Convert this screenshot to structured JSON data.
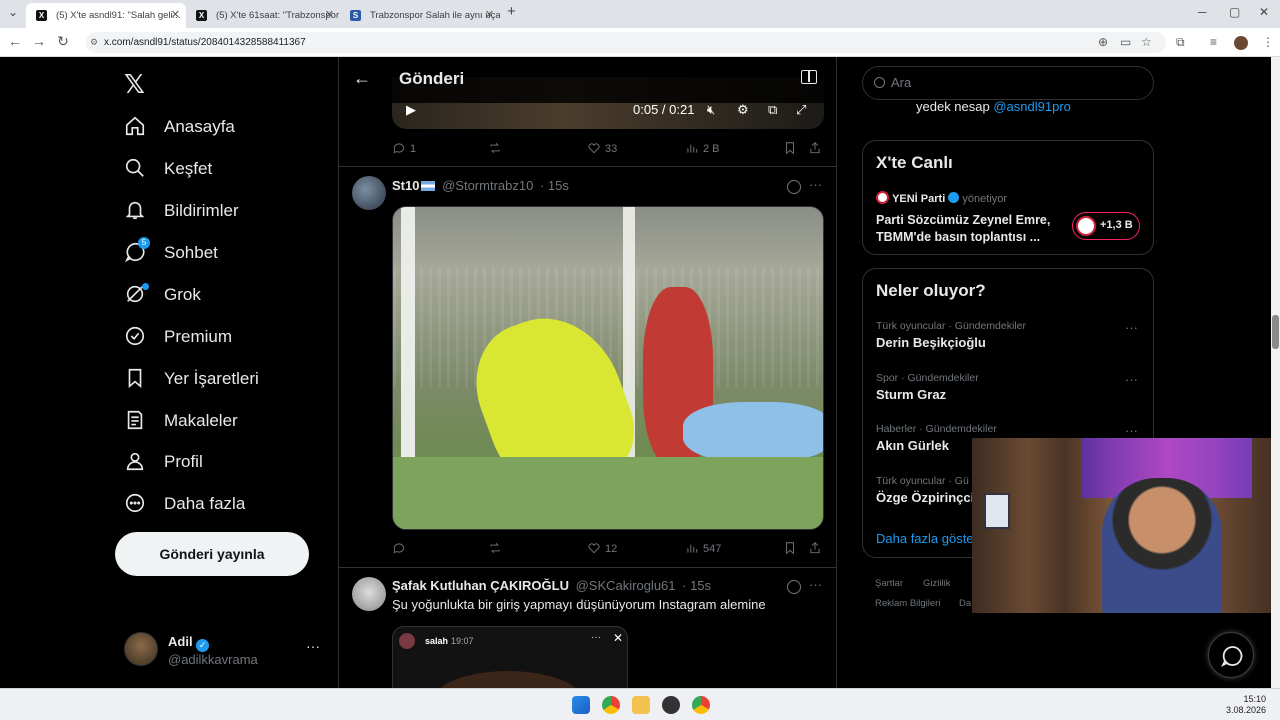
{
  "browser": {
    "tabs": [
      {
        "label": "(5) X'te asndl91: \"Salah geli...",
        "active": true
      },
      {
        "label": "(5) X'te 61saat: \"Trabzonspor Sa...",
        "active": false
      },
      {
        "label": "Trabzonspor Salah ile aynı uçak...",
        "active": false
      }
    ],
    "new_tab": "+",
    "url": "x.com/asndl91/status/2084014328588411367"
  },
  "nav": {
    "items": [
      {
        "label": "Anasayfa",
        "icon": "home-icon"
      },
      {
        "label": "Keşfet",
        "icon": "search-icon"
      },
      {
        "label": "Bildirimler",
        "icon": "bell-icon"
      },
      {
        "label": "Sohbet",
        "icon": "chat-icon",
        "badge": "5"
      },
      {
        "label": "Grok",
        "icon": "grok-icon"
      },
      {
        "label": "Premium",
        "icon": "premium-icon"
      },
      {
        "label": "Yer İşaretleri",
        "icon": "bookmark-icon"
      },
      {
        "label": "Makaleler",
        "icon": "article-icon"
      },
      {
        "label": "Profil",
        "icon": "person-icon"
      },
      {
        "label": "Daha fazla",
        "icon": "more-circle-icon"
      }
    ],
    "post_button": "Gönderi yayınla",
    "account": {
      "name": "Adil",
      "handle": "@adilkkavrama",
      "more": "···"
    }
  },
  "main": {
    "title": "Gönderi",
    "video1": {
      "time": "0:05 / 0:21"
    },
    "post1_actions": {
      "replies": "1",
      "reposts": "",
      "likes": "33",
      "views": "2 B"
    },
    "post2": {
      "name": "St10",
      "handle": "@Stormtrabz10",
      "time": "· 15s",
      "actions": {
        "replies": "",
        "reposts": "",
        "likes": "12",
        "views": "547"
      }
    },
    "post3": {
      "name": "Şafak Kutluhan ÇAKIROĞLU",
      "handle": "@SKCakiroglu61",
      "time": "· 15s",
      "text": "Şu yoğunlukta bir giriş yapmayı düşünüyorum Instagram alemine",
      "embed_user": "salah",
      "embed_time": "19:07"
    }
  },
  "right": {
    "search_placeholder": "Ara",
    "partial_text": "yedek nesap",
    "partial_link": "@asndl91pro",
    "live": {
      "title": "X'te Canlı",
      "host": "YENİ Parti",
      "host_role": "yönetiyor",
      "headline": "Parti Sözcümüz Zeynel Emre, TBMM'de basın toplantısı ...",
      "listeners": "+1,3 B"
    },
    "trends": {
      "title": "Neler oluyor?",
      "items": [
        {
          "meta": "Türk oyuncular · Gündemdekiler",
          "name": "Derin Beşikçioğlu"
        },
        {
          "meta": "Spor · Gündemdekiler",
          "name": "Sturm Graz"
        },
        {
          "meta": "Haberler · Gündemdekiler",
          "name": "Akın Gürlek"
        },
        {
          "meta": "Türk oyuncular · Gü",
          "name": "Özge Özpirinçci"
        }
      ],
      "show_more": "Daha fazla göste"
    },
    "footer": [
      "Şartlar",
      "Gizlilik",
      "Reklam Bilgileri",
      "Da"
    ]
  },
  "taskbar": {
    "time": "15:10",
    "date": "3.08.2026"
  }
}
